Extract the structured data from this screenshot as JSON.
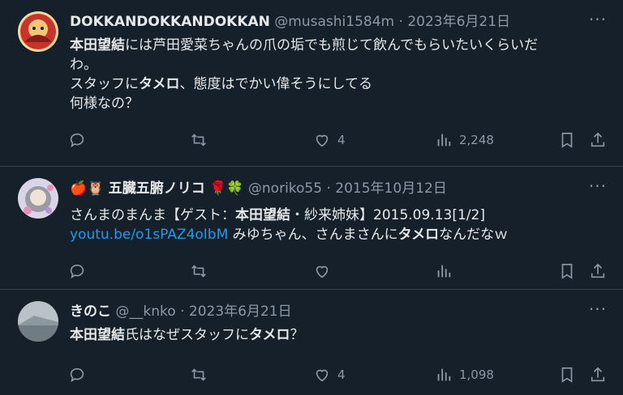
{
  "tweets": [
    {
      "name": "DOKKANDOKKANDOKKAN",
      "handle": "@musashi1584m",
      "sep": "·",
      "date": "2023年6月21日",
      "more": "···",
      "lines": [
        [
          "本田望結",
          "には芦田愛菜ちゃんの爪の垢でも煎じて飲んでもらいたいくらいだ"
        ],
        [
          "わ。"
        ],
        [
          "スタッフに",
          "タメロ",
          "、態度はでかい偉そうにしてる"
        ],
        [
          "何様なの？"
        ]
      ],
      "likes": "4",
      "views": "2,248"
    },
    {
      "name_prefix": "🍎🦉",
      "name": "五臓五腑ノリコ",
      "name_suffix": "🌹🍀",
      "handle": "@noriko55",
      "sep": "·",
      "date": "2015年10月12日",
      "more": "···",
      "line1a": "さんまのまんま【ゲスト：",
      "line1b": "本田望結",
      "line1c": "・紗来姉妹】2015.09.13[1/2]",
      "link": "youtu.be/o1sPAZ4oIbM",
      "line2a": " みゆちゃん、さんまさんに",
      "line2b": "タメロ",
      "line2c": "なんだなｗ",
      "likes": "",
      "views": ""
    },
    {
      "name": "きのこ",
      "handle": "@__knko",
      "sep": "·",
      "date": "2023年6月21日",
      "more": "···",
      "b1": "本田望結",
      "t1": "氏はなぜスタッフに",
      "b2": "タメロ",
      "t2": "？",
      "likes": "4",
      "views": "1,098"
    }
  ],
  "colors": {
    "bg": "#15202b",
    "text": "#e7e9ea",
    "muted": "#8b98a5",
    "link": "#1d9bf0",
    "border": "#38444d"
  },
  "icons": [
    "reply-icon",
    "retweet-icon",
    "like-icon",
    "views-icon",
    "bookmark-icon",
    "share-icon",
    "more-icon"
  ]
}
